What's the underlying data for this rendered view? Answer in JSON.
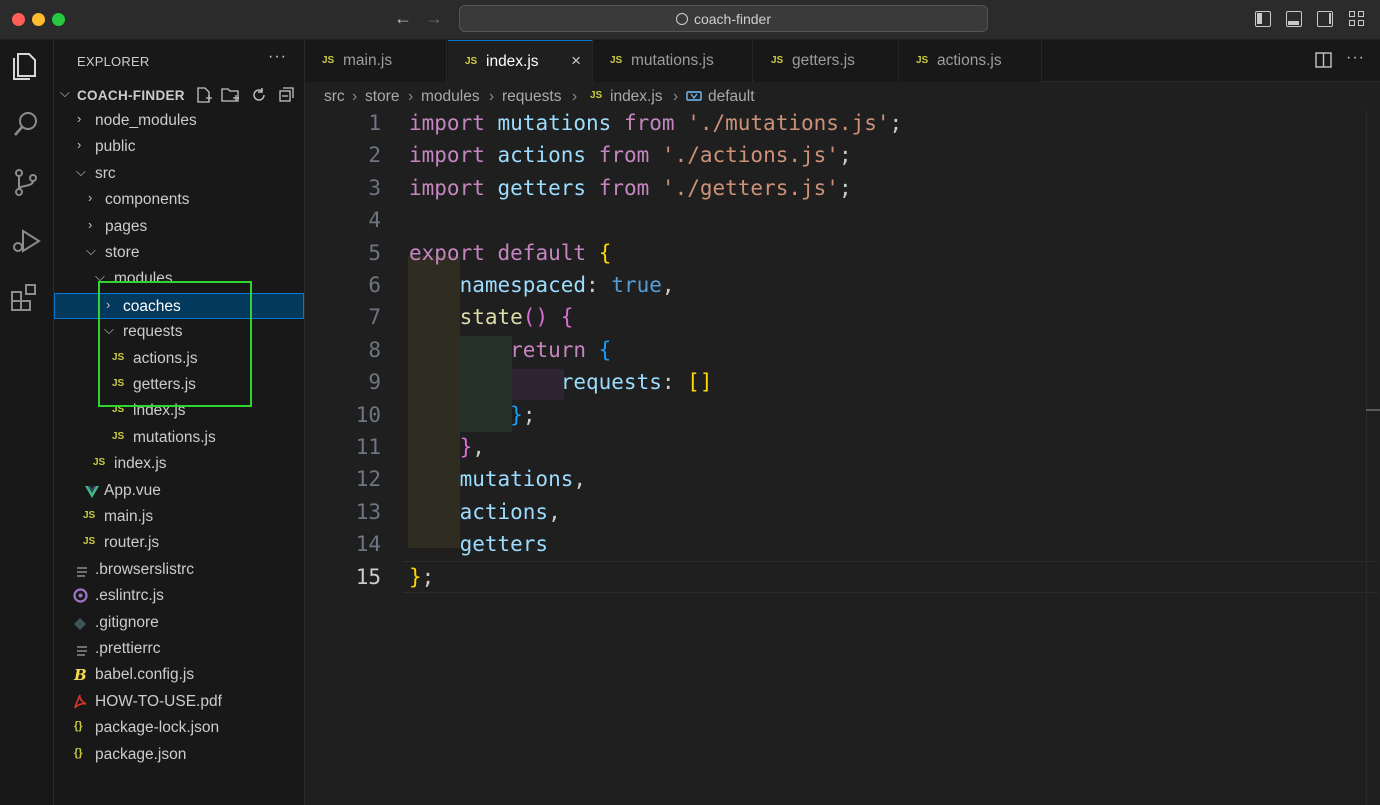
{
  "window": {
    "title": "coach-finder",
    "traffic_colors": [
      "#ff5f57",
      "#febc2e",
      "#28c840"
    ]
  },
  "sidebar": {
    "title": "EXPLORER",
    "more": "···",
    "root": "COACH-FINDER",
    "tree": [
      {
        "label": "node_modules",
        "icon": "chevron-right"
      },
      {
        "label": "public",
        "icon": "chevron-right"
      },
      {
        "label": "src",
        "icon": "chevron-down"
      },
      {
        "label": "components",
        "icon": "chevron-right"
      },
      {
        "label": "pages",
        "icon": "chevron-right"
      },
      {
        "label": "store",
        "icon": "chevron-down"
      },
      {
        "label": "modules",
        "icon": "chevron-down"
      },
      {
        "label": "coaches",
        "icon": "chevron-right",
        "selected": true
      },
      {
        "label": "requests",
        "icon": "chevron-down"
      },
      {
        "label": "actions.js",
        "icon": "js-file-icon"
      },
      {
        "label": "getters.js",
        "icon": "js-file-icon"
      },
      {
        "label": "index.js",
        "icon": "js-file-icon"
      },
      {
        "label": "mutations.js",
        "icon": "js-file-icon"
      },
      {
        "label": "index.js",
        "icon": "js-file-icon"
      },
      {
        "label": "App.vue",
        "icon": "vue-file-icon"
      },
      {
        "label": "main.js",
        "icon": "js-file-icon"
      },
      {
        "label": "router.js",
        "icon": "js-file-icon"
      },
      {
        "label": ".browserslistrc",
        "icon": "lines-file-icon"
      },
      {
        "label": ".eslintrc.js",
        "icon": "eslint-file-icon"
      },
      {
        "label": ".gitignore",
        "icon": "git-file-icon"
      },
      {
        "label": ".prettierrc",
        "icon": "lines-file-icon"
      },
      {
        "label": "babel.config.js",
        "icon": "babel-file-icon"
      },
      {
        "label": "HOW-TO-USE.pdf",
        "icon": "pdf-file-icon"
      },
      {
        "label": "package-lock.json",
        "icon": "json-file-icon"
      },
      {
        "label": "package.json",
        "icon": "json-file-icon"
      }
    ]
  },
  "tabs": [
    {
      "label": "main.js",
      "icon": "JS"
    },
    {
      "label": "index.js",
      "icon": "JS",
      "active": true,
      "close": "×"
    },
    {
      "label": "mutations.js",
      "icon": "JS"
    },
    {
      "label": "getters.js",
      "icon": "JS"
    },
    {
      "label": "actions.js",
      "icon": "JS"
    }
  ],
  "breadcrumb": [
    "src",
    "store",
    "modules",
    "requests",
    "index.js",
    "default"
  ],
  "editor": {
    "line_numbers": [
      "1",
      "2",
      "3",
      "4",
      "5",
      "6",
      "7",
      "8",
      "9",
      "10",
      "11",
      "12",
      "13",
      "14",
      "15"
    ],
    "current_line": 15
  },
  "file_icon_text": {
    "js": "JS",
    "json": "{}"
  },
  "colors": {
    "keyword": "#c586c0",
    "string": "#ce9178",
    "variable": "#9cdcfe",
    "function": "#dcdcaa",
    "boolean": "#569cd6",
    "js_icon": "#cbcb41",
    "selection": "#04395e",
    "highlight_box": "#2fd42f"
  }
}
